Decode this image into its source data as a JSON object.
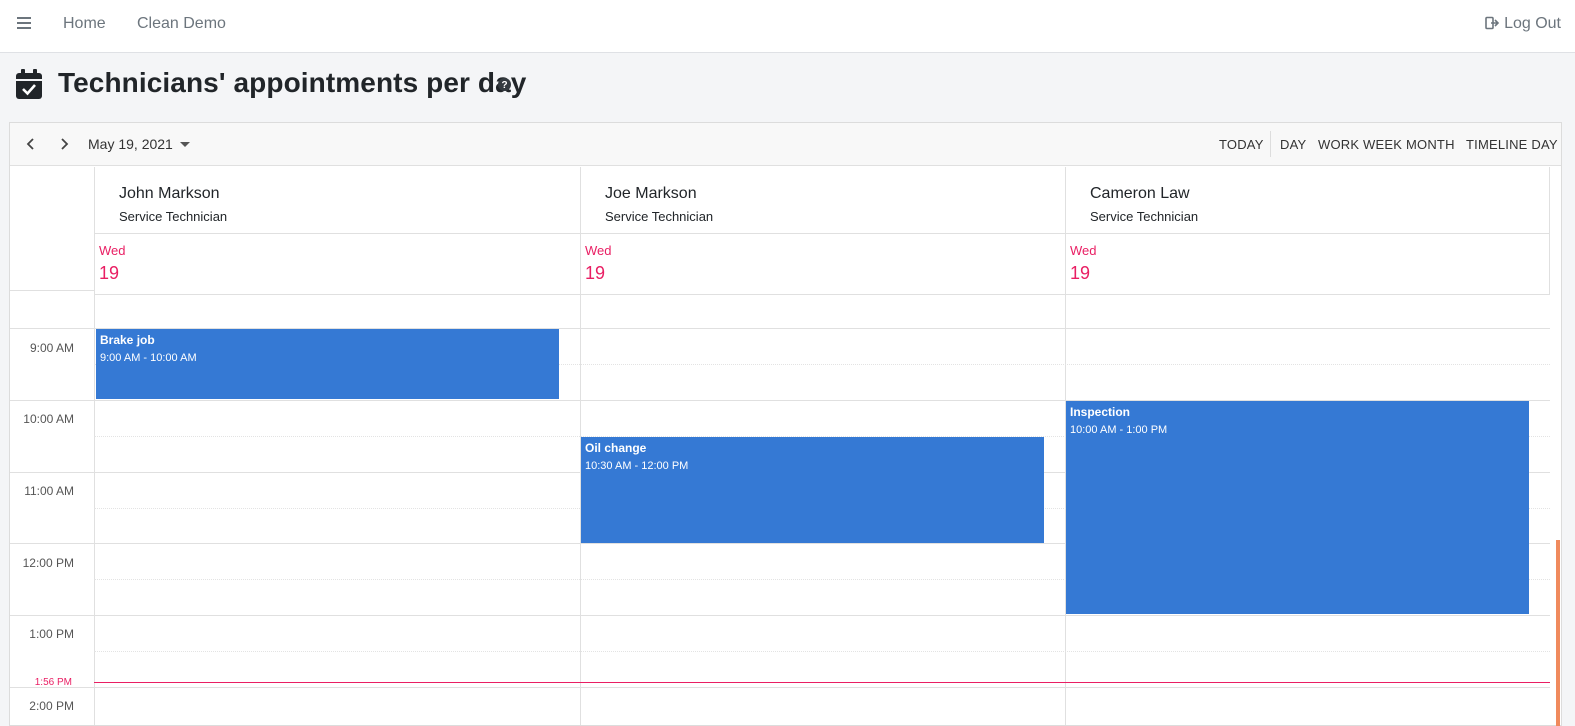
{
  "nav": {
    "home": "Home",
    "clean_demo": "Clean Demo",
    "logout": "Log Out"
  },
  "page": {
    "title": "Technicians' appointments per day"
  },
  "toolbar": {
    "date": "May 19, 2021",
    "today": "TODAY",
    "day": "DAY",
    "work_week": "WORK WEEK",
    "month": "MONTH",
    "timeline_day": "TIMELINE DAY"
  },
  "resources": [
    {
      "name": "John Markson",
      "role": "Service Technician",
      "day_name": "Wed",
      "day_num": "19"
    },
    {
      "name": "Joe Markson",
      "role": "Service Technician",
      "day_name": "Wed",
      "day_num": "19"
    },
    {
      "name": "Cameron Law",
      "role": "Service Technician",
      "day_name": "Wed",
      "day_num": "19"
    }
  ],
  "times": [
    "9:00 AM",
    "10:00 AM",
    "11:00 AM",
    "12:00 PM",
    "1:00 PM",
    "2:00 PM"
  ],
  "now": "1:56 PM",
  "appointments": [
    {
      "title": "Brake job",
      "time": "9:00 AM - 10:00 AM"
    },
    {
      "title": "Oil change",
      "time": "10:30 AM - 12:00 PM"
    },
    {
      "title": "Inspection",
      "time": "10:00 AM - 1:00 PM"
    }
  ],
  "colors": {
    "appointment": "#3579d4",
    "today_accent": "#e91e63"
  }
}
